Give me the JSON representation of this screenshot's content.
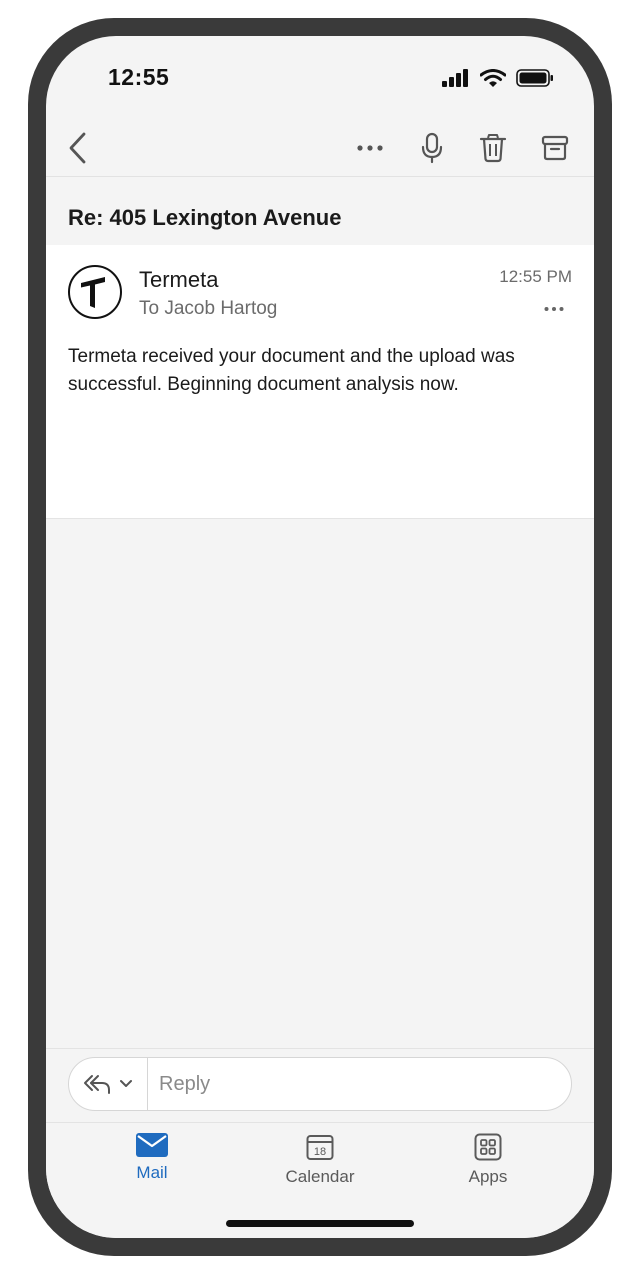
{
  "status_bar": {
    "time": "12:55"
  },
  "header": {
    "subject": "Re: 405 Lexington Avenue"
  },
  "message": {
    "sender": "Termeta",
    "recipient": "To Jacob Hartog",
    "time": "12:55 PM",
    "body": "Termeta received your document and the upload was successful. Beginning document analysis now."
  },
  "reply": {
    "placeholder": "Reply"
  },
  "tabs": [
    {
      "label": "Mail",
      "active": true
    },
    {
      "label": "Calendar",
      "calendar_day": "18"
    },
    {
      "label": "Apps"
    }
  ],
  "colors": {
    "accent": "#1f6bbf",
    "background": "#f4f4f4",
    "frame": "#3a3a3a"
  }
}
